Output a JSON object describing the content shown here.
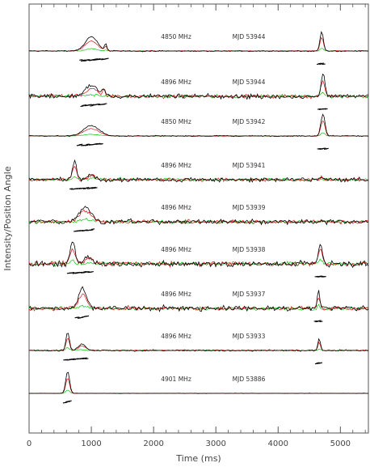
{
  "chart_data": {
    "type": "line",
    "title": "",
    "xlabel": "Time (ms)",
    "ylabel": "Intensity/Position Angle",
    "xlim": [
      0,
      5450
    ],
    "xticks": [
      0,
      1000,
      2000,
      3000,
      4000,
      5000
    ],
    "xtick_labels": [
      "0",
      "1000",
      "2000",
      "3000",
      "4000",
      "5000"
    ],
    "colors": {
      "total": "#000000",
      "linear": "#e01010",
      "circular": "#10c010",
      "axes": "#555555"
    },
    "panels": [
      {
        "freq": "4850 MHz",
        "mjd": "MJD 53944",
        "noise": 0.03,
        "components": [
          {
            "center": 1000,
            "width": 330,
            "amp": 0.55
          },
          {
            "center": 1230,
            "width": 60,
            "amp": 0.25
          }
        ],
        "interpulse": {
          "center": 4700,
          "width": 90,
          "amp": 0.75
        }
      },
      {
        "freq": "4896 MHz",
        "mjd": "MJD 53944",
        "noise": 0.13,
        "components": [
          {
            "center": 1000,
            "width": 300,
            "amp": 0.45
          },
          {
            "center": 1200,
            "width": 80,
            "amp": 0.3
          }
        ],
        "interpulse": {
          "center": 4720,
          "width": 100,
          "amp": 0.9
        }
      },
      {
        "freq": "4850 MHz",
        "mjd": "MJD 53942",
        "noise": 0.03,
        "components": [
          {
            "center": 1000,
            "width": 420,
            "amp": 0.4
          }
        ],
        "interpulse": {
          "center": 4720,
          "width": 110,
          "amp": 0.85
        }
      },
      {
        "freq": "4896 MHz",
        "mjd": "MJD 53941",
        "noise": 0.12,
        "components": [
          {
            "center": 730,
            "width": 110,
            "amp": 0.7
          },
          {
            "center": 1000,
            "width": 200,
            "amp": 0.2
          }
        ],
        "interpulse": {
          "center": 4700,
          "width": 80,
          "amp": 0.12
        }
      },
      {
        "freq": "4896 MHz",
        "mjd": "MJD 53939",
        "noise": 0.14,
        "components": [
          {
            "center": 900,
            "width": 320,
            "amp": 0.6
          }
        ],
        "interpulse": {
          "center": 4700,
          "width": 80,
          "amp": 0.1
        }
      },
      {
        "freq": "4896 MHz",
        "mjd": "MJD 53938",
        "noise": 0.16,
        "components": [
          {
            "center": 700,
            "width": 130,
            "amp": 0.85
          },
          {
            "center": 950,
            "width": 200,
            "amp": 0.3
          }
        ],
        "interpulse": {
          "center": 4680,
          "width": 110,
          "amp": 0.8
        }
      },
      {
        "freq": "4896 MHz",
        "mjd": "MJD 53937",
        "noise": 0.14,
        "components": [
          {
            "center": 860,
            "width": 200,
            "amp": 0.8
          }
        ],
        "interpulse": {
          "center": 4650,
          "width": 80,
          "amp": 0.6
        }
      },
      {
        "freq": "4896 MHz",
        "mjd": "MJD 53933",
        "noise": 0.04,
        "components": [
          {
            "center": 620,
            "width": 90,
            "amp": 0.7
          },
          {
            "center": 850,
            "width": 200,
            "amp": 0.25
          }
        ],
        "interpulse": {
          "center": 4660,
          "width": 70,
          "amp": 0.45
        }
      },
      {
        "freq": "4901 MHz",
        "mjd": "MJD 53886",
        "noise": 0.01,
        "components": [
          {
            "center": 620,
            "width": 100,
            "amp": 0.85
          }
        ],
        "interpulse": null
      }
    ]
  }
}
